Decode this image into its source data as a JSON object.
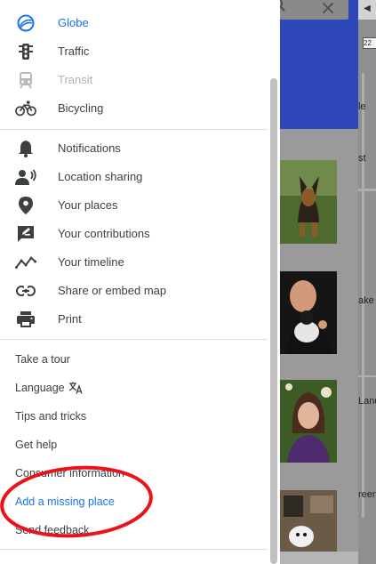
{
  "layers": [
    {
      "label": "Globe",
      "icon": "globe-icon",
      "state": "active"
    },
    {
      "label": "Traffic",
      "icon": "traffic-light-icon",
      "state": "normal"
    },
    {
      "label": "Transit",
      "icon": "transit-icon",
      "state": "disabled"
    },
    {
      "label": "Bicycling",
      "icon": "bicycle-icon",
      "state": "normal"
    }
  ],
  "personal": [
    {
      "label": "Notifications",
      "icon": "bell-icon"
    },
    {
      "label": "Location sharing",
      "icon": "location-sharing-icon"
    },
    {
      "label": "Your places",
      "icon": "place-pin-icon"
    },
    {
      "label": "Your contributions",
      "icon": "contributions-icon"
    },
    {
      "label": "Your timeline",
      "icon": "timeline-icon"
    },
    {
      "label": "Share or embed map",
      "icon": "link-icon"
    },
    {
      "label": "Print",
      "icon": "printer-icon"
    }
  ],
  "help": {
    "take_tour": "Take a tour",
    "language": "Language",
    "tips": "Tips and tricks",
    "get_help": "Get help",
    "consumer_info": "Consumer information",
    "add_missing_place": "Add a missing place",
    "send_feedback": "Send feedback"
  },
  "background": {
    "map_labels": [
      "le",
      "st",
      "ake R",
      "Land",
      "reen"
    ],
    "route_badge": "22"
  },
  "colors": {
    "accent": "#1a73e8",
    "text": "#3c4043",
    "disabled": "#b0b0b0",
    "header_blue": "#2d47b8",
    "highlight_ring": "#e8141b"
  }
}
